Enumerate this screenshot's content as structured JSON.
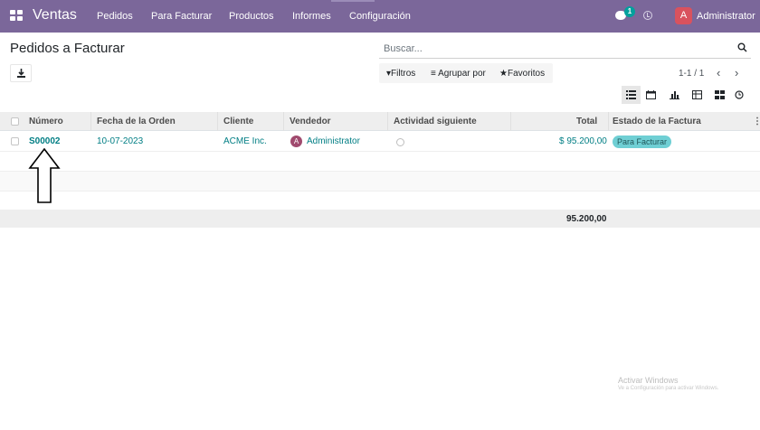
{
  "navbar": {
    "brand": "Ventas",
    "menu": [
      {
        "label": "Pedidos"
      },
      {
        "label": "Para Facturar"
      },
      {
        "label": "Productos"
      },
      {
        "label": "Informes"
      },
      {
        "label": "Configuración"
      }
    ],
    "messages_count": "1",
    "user": {
      "initial": "A",
      "name": "Administrator"
    }
  },
  "page": {
    "title": "Pedidos a Facturar"
  },
  "search": {
    "placeholder": "Buscar..."
  },
  "filters": {
    "filtros": "Filtros",
    "agrupar": "Agrupar por",
    "favoritos": "Favoritos"
  },
  "pager": {
    "value": "1-1 / 1",
    "prev": "‹",
    "next": "›"
  },
  "views": [
    "list-view-icon",
    "calendar-view-icon",
    "graph-view-icon",
    "pivot-view-icon",
    "kanban-view-icon",
    "activity-view-icon"
  ],
  "table": {
    "columns": [
      "Número",
      "Fecha de la Orden",
      "Cliente",
      "Vendedor",
      "Actividad siguiente",
      "Total",
      "Estado de la Factura"
    ],
    "rows": [
      {
        "numero": "S00002",
        "fecha": "10-07-2023",
        "cliente": "ACME Inc.",
        "vendedor_initial": "A",
        "vendedor": "Administrator",
        "total": "$ 95.200,00",
        "estado": "Para Facturar"
      }
    ],
    "footer_total": "95.200,00"
  },
  "watermark": {
    "title": "Activar Windows",
    "subtitle": "Ve a Configuración para activar Windows."
  },
  "colors": {
    "navbar": "#7b679a",
    "link": "#017e84",
    "badge": "#6fcfd4",
    "chat_badge": "#00a09d",
    "user_avatar": "#d9525e"
  }
}
